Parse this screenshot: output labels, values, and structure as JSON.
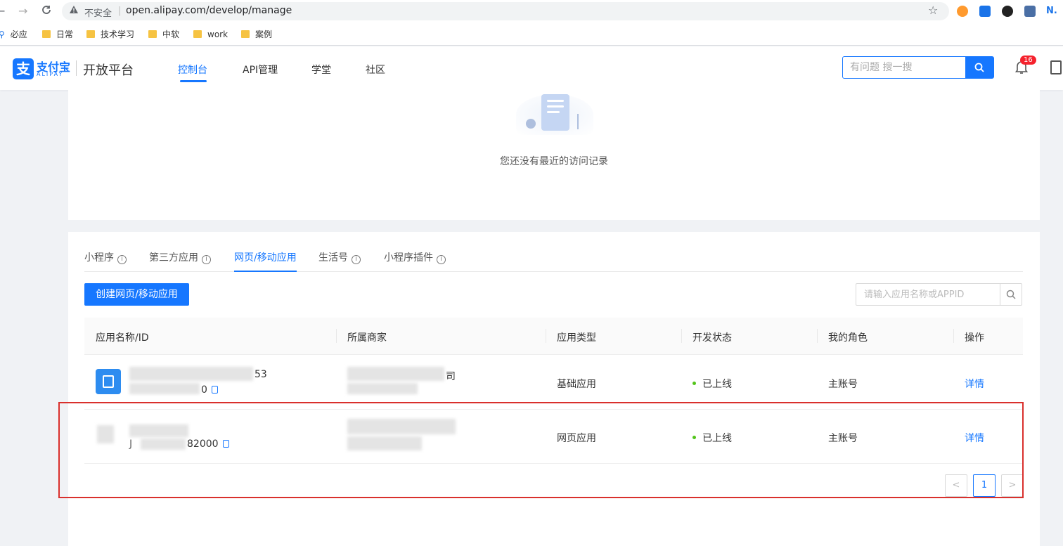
{
  "browser": {
    "back": "←",
    "forward": "→",
    "reload": "C",
    "insecure": "不安全",
    "url": "open.alipay.com/develop/manage",
    "bookmarks": [
      "必应",
      "日常",
      "技术学习",
      "中软",
      "work",
      "案例"
    ]
  },
  "header": {
    "logo_cn": "支付宝",
    "logo_en": "ALIPAY",
    "platform": "开放平台",
    "nav": [
      "控制台",
      "API管理",
      "学堂",
      "社区"
    ],
    "active_nav": "控制台",
    "search_placeholder": "有问题 搜一搜",
    "notification_count": "16"
  },
  "recent": {
    "empty_text": "您还没有最近的访问记录"
  },
  "apps": {
    "tabs": [
      "小程序",
      "第三方应用",
      "网页/移动应用",
      "生活号",
      "小程序插件"
    ],
    "active_tab": "网页/移动应用",
    "create_button": "创建网页/移动应用",
    "filter_placeholder": "请输入应用名称或APPID",
    "columns": [
      "应用名称/ID",
      "所属商家",
      "应用类型",
      "开发状态",
      "我的角色",
      "操作"
    ],
    "rows": [
      {
        "name_tail": "53",
        "id_tail": "0",
        "merchant_tail": "司",
        "type": "基础应用",
        "status": "已上线",
        "role": "主账号",
        "action": "详情"
      },
      {
        "id_head": "J",
        "id_tail": "82000",
        "type": "网页应用",
        "status": "已上线",
        "role": "主账号",
        "action": "详情"
      }
    ],
    "pagination": {
      "prev": "<",
      "current": "1",
      "next": ">"
    }
  },
  "colors": {
    "brand": "#1677ff",
    "highlight": "#d9302c",
    "status_online": "#52c41a"
  }
}
